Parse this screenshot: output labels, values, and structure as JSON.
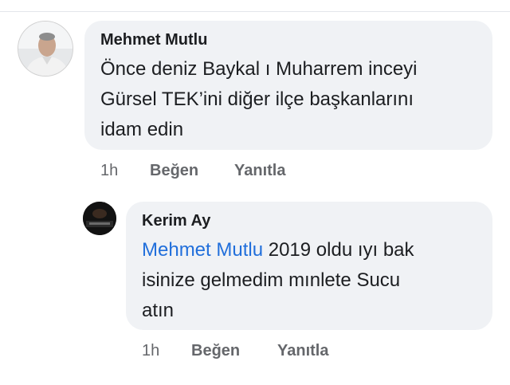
{
  "comment": {
    "author": "Mehmet Mutlu",
    "lines": [
      "Önce deniz Baykal ı  Muharrem inceyi",
      "Gürsel TEK’ini diğer ilçe başkanlarını",
      "idam edin"
    ],
    "time": "1h",
    "like_label": "Beğen",
    "reply_label": "Yanıtla"
  },
  "reply": {
    "author": "Kerim Ay",
    "mention": "Mehmet Mutlu",
    "line1_rest": " 2019 oldu ıyı bak",
    "lines": [
      "isinize gelmedim mınlete Sucu",
      "atın"
    ],
    "time": "1h",
    "like_label": "Beğen",
    "reply_label": "Yanıtla"
  },
  "colors": {
    "bubble": "#f0f2f5",
    "mention": "#216fdb",
    "meta": "#65676b"
  }
}
